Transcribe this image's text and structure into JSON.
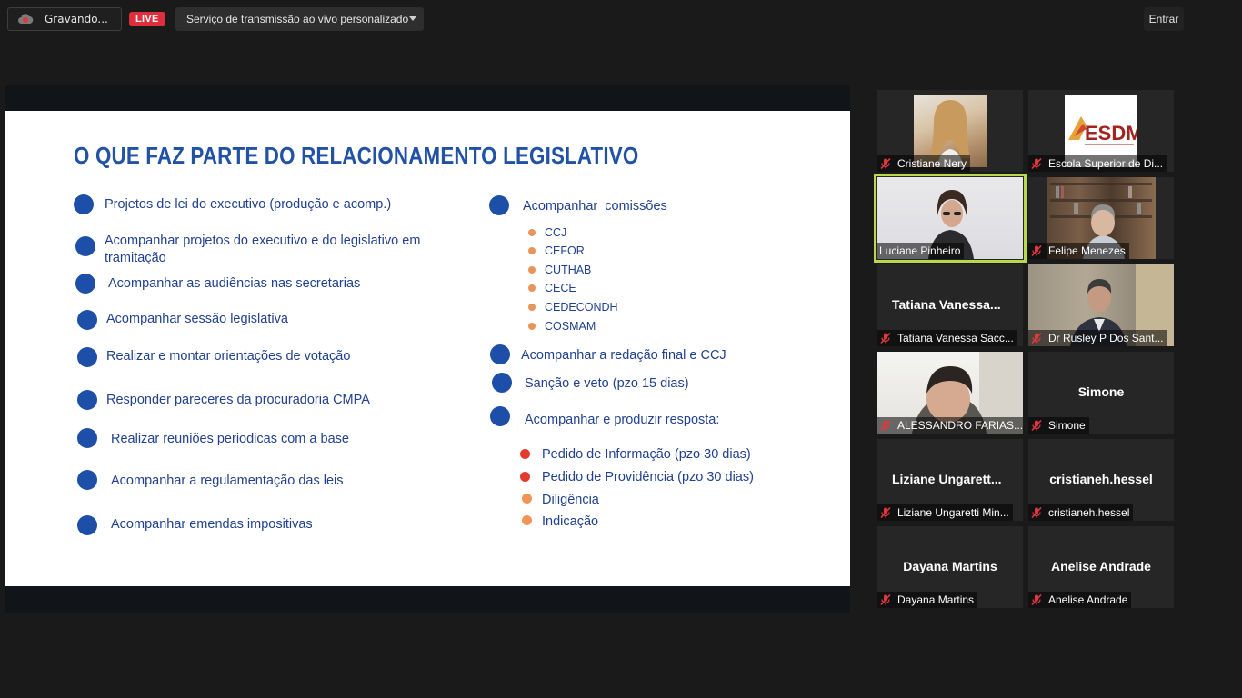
{
  "topbar": {
    "recording_label": "Gravando...",
    "live_label": "LIVE",
    "stream_service": "Serviço de transmissão ao vivo personalizado",
    "enter_label": "Entrar"
  },
  "slide": {
    "title": "O QUE FAZ PARTE DO RELACIONAMENTO LEGISLATIVO",
    "left_items": [
      "Projetos de lei do executivo (produção e acomp.)",
      "Acompanhar projetos do executivo e do legislativo em tramitação",
      "Acompanhar as audiências nas secretarias",
      "Acompanhar sessão legislativa",
      "Realizar e montar orientações de votação",
      "Responder pareceres da procuradoria CMPA",
      "Realizar reuniões periodicas com a base",
      "Acompanhar a regulamentação das leis",
      "Acompanhar emendas impositivas"
    ],
    "right_items": {
      "commissions_label": "Acompanhar  comissões",
      "commissions": [
        "CCJ",
        "CEFOR",
        "CUTHAB",
        "CECE",
        "CEDECONDH",
        "COSMAM"
      ],
      "final_label": "Acompanhar a redação final e CCJ",
      "sanction_label": "Sanção e veto (pzo 15 dias)",
      "response_label": "Acompanhar e produzir resposta:",
      "responses": [
        "Pedido de Informação (pzo 30 dias)",
        "Pedido de Providência (pzo 30 dias)",
        "Diligência",
        "Indicação"
      ]
    }
  },
  "participants": [
    {
      "name": "Cristiane Nery",
      "big": ""
    },
    {
      "name": "Escola Superior de Di...",
      "big": "",
      "logo_text": "ESDM"
    },
    {
      "name": "Luciane Pinheiro",
      "big": "",
      "active": true
    },
    {
      "name": "Felipe Menezes",
      "big": ""
    },
    {
      "name": "Tatiana Vanessa Sacc...",
      "big": "Tatiana  Vanessa..."
    },
    {
      "name": "Dr Rusley P Dos Sant...",
      "big": ""
    },
    {
      "name": "ALESSANDRO FARIAS...",
      "big": ""
    },
    {
      "name": "Simone",
      "big": "Simone"
    },
    {
      "name": "Liziane Ungaretti Min...",
      "big": "Liziane  Ungarett..."
    },
    {
      "name": "cristianeh.hessel",
      "big": "cristianeh.hessel"
    },
    {
      "name": "Dayana Martins",
      "big": "Dayana Martins"
    },
    {
      "name": "Anelise Andrade",
      "big": "Anelise Andrade"
    }
  ],
  "colors": {
    "live": "#e02f3c",
    "slide_title": "#2152a6",
    "bullet": "#1d4fa8",
    "active_speaker": "#b9d84d",
    "muted_icon": "#e0383e"
  }
}
